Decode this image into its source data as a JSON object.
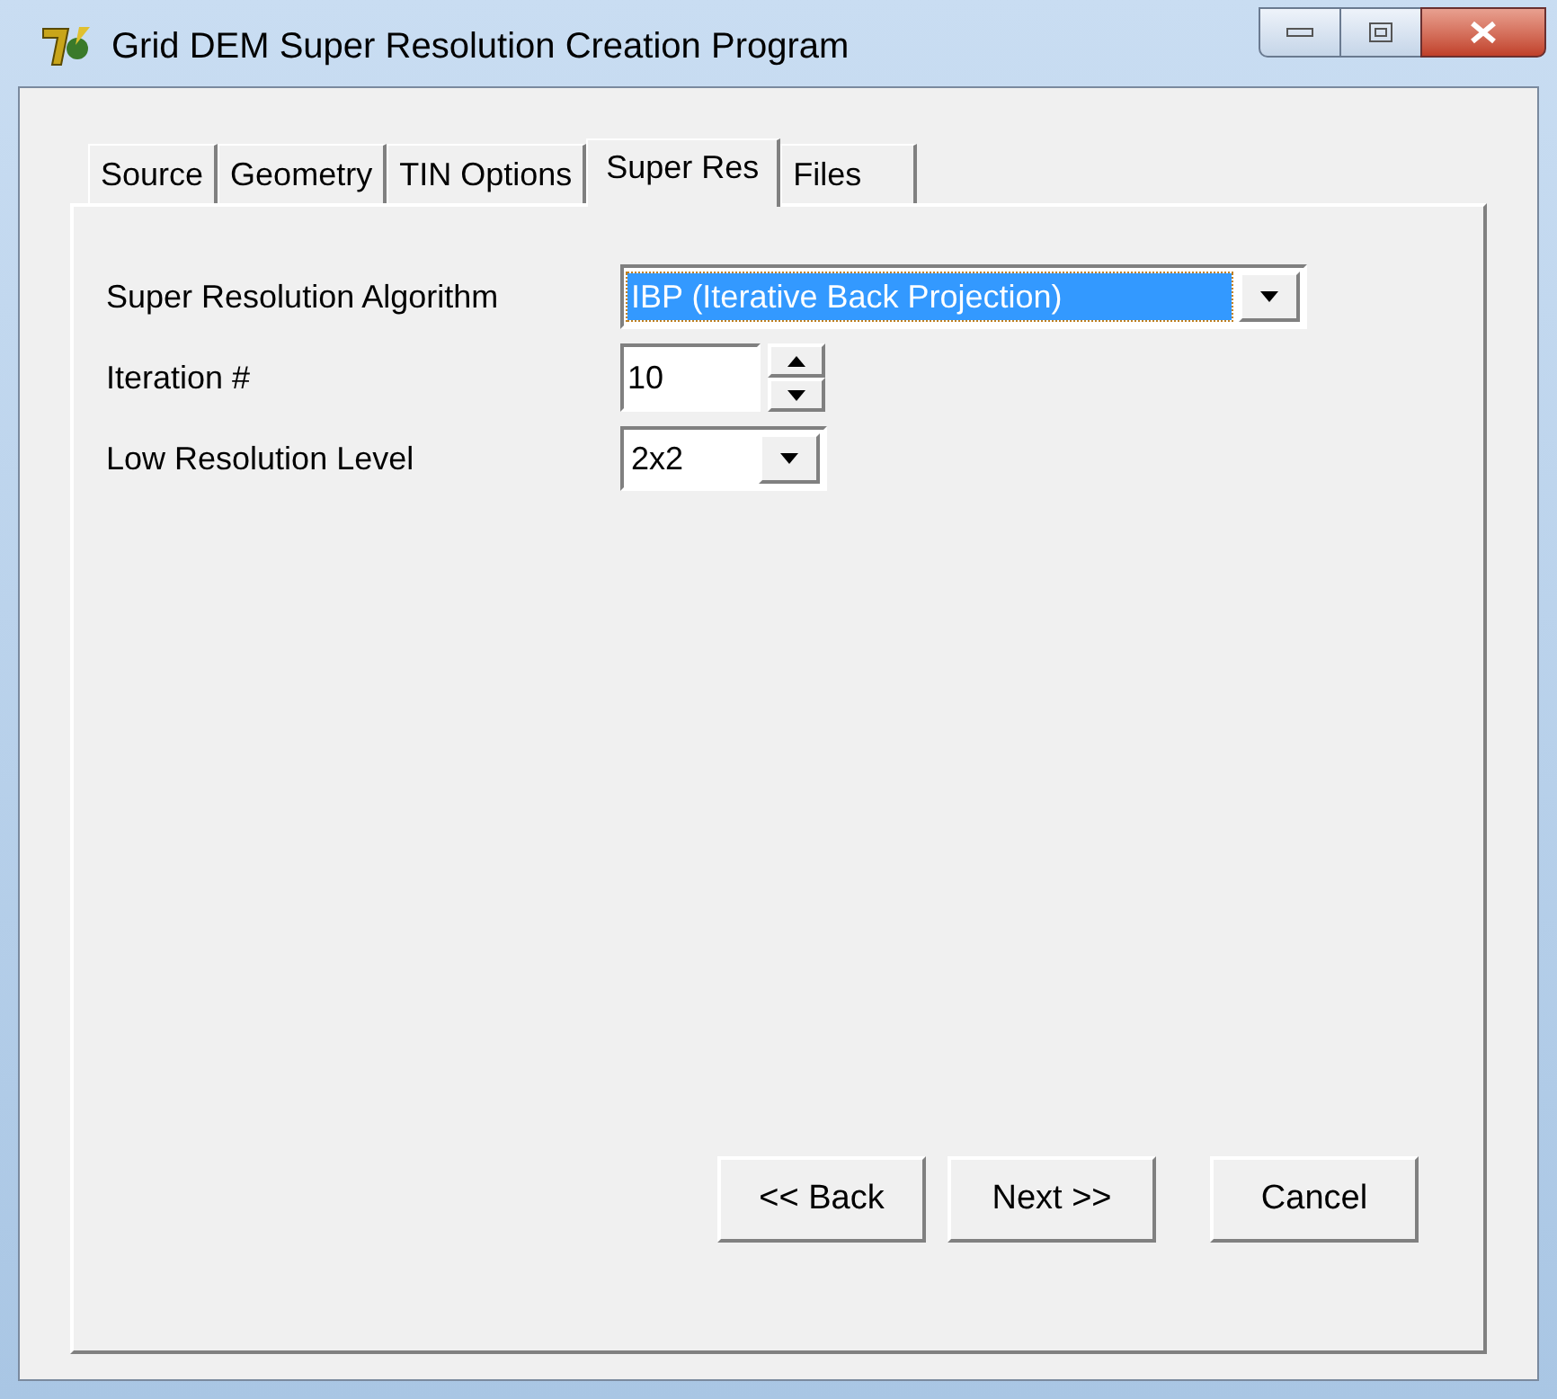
{
  "window": {
    "title": "Grid DEM Super Resolution Creation Program"
  },
  "tabs": [
    {
      "label": "Source",
      "selected": false
    },
    {
      "label": "Geometry",
      "selected": false
    },
    {
      "label": "TIN Options",
      "selected": false
    },
    {
      "label": "Super Res",
      "selected": true
    },
    {
      "label": "Files",
      "selected": false
    }
  ],
  "fields": [
    {
      "kind": "combo",
      "label": "Super Resolution Algorithm",
      "value": "IBP (Iterative Back Projection)",
      "focused": true
    },
    {
      "kind": "spin",
      "label": "Iteration #",
      "value": "10",
      "focused": false
    },
    {
      "kind": "combo",
      "label": "Low Resolution Level",
      "value": "2x2",
      "focused": false
    }
  ],
  "buttons": [
    "<< Back",
    "Next >>",
    "Cancel"
  ]
}
